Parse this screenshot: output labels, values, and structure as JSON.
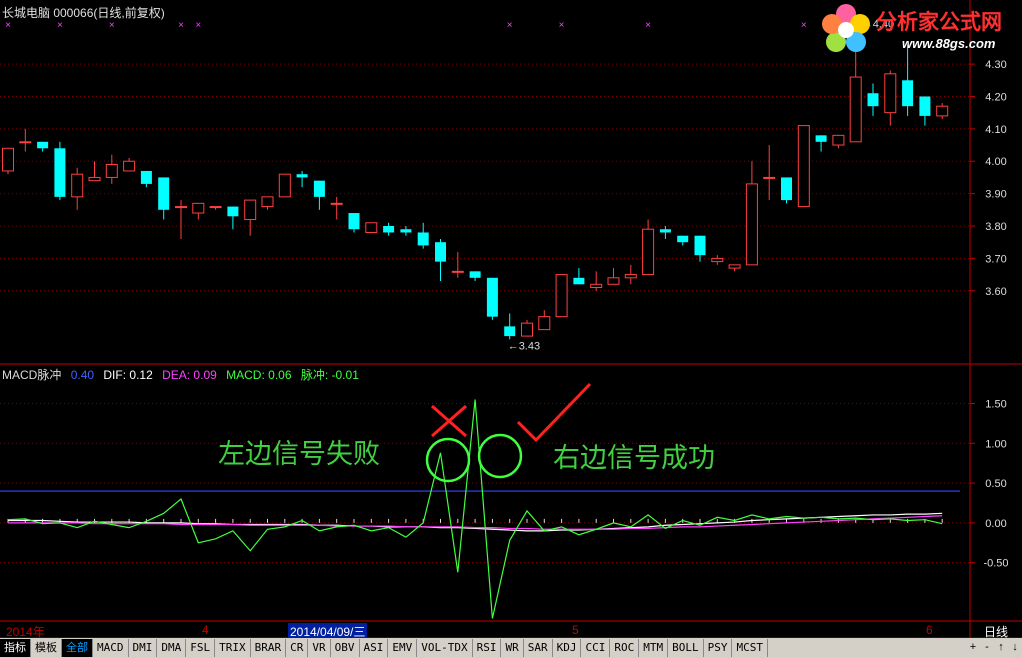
{
  "window": {
    "title": "长城电脑 000066(日线,前复权)"
  },
  "logo": {
    "brand": "分析家公式网",
    "url": "www.88gs.com"
  },
  "macd_header": {
    "name": "MACD脉冲",
    "param": "0.40",
    "dif_label": "DIF: 0.12",
    "dea_label": "DEA: 0.09",
    "macd_label": "MACD: 0.06",
    "pulse_label": "脉冲: -0.01"
  },
  "annotations": {
    "left": "左边信号失败",
    "right": "右边信号成功"
  },
  "date_axis": {
    "year": "2014年",
    "m4": "4",
    "selected_date": "2014/04/09/三",
    "m5": "5",
    "m6": "6",
    "period": "日线"
  },
  "bottom_tabs": [
    "指标",
    "模板",
    "全部",
    "MACD",
    "DMI",
    "DMA",
    "FSL",
    "TRIX",
    "BRAR",
    "CR",
    "VR",
    "OBV",
    "ASI",
    "EMV",
    "VOL-TDX",
    "RSI",
    "WR",
    "SAR",
    "KDJ",
    "CCI",
    "ROC",
    "MTM",
    "BOLL",
    "PSY",
    "MCST"
  ],
  "bottom_ctrl": [
    "+",
    "-",
    "↑",
    "↓"
  ],
  "colors": {
    "up": "#ff4040",
    "down": "#00ffff",
    "dif": "#ffffff",
    "dea": "#ff40ff",
    "pulse": "#40ff40",
    "level_line": "#4040ff",
    "grid": "#800000"
  },
  "chart_data": [
    {
      "type": "candlestick",
      "yticks": [
        3.6,
        3.7,
        3.8,
        3.9,
        4.0,
        4.1,
        4.2,
        4.3
      ],
      "ylim": [
        3.38,
        4.43
      ],
      "annotation_low": "3.43",
      "annotation_high": "4.40",
      "candles": [
        {
          "o": 3.97,
          "h": 4.04,
          "l": 3.96,
          "c": 4.04
        },
        {
          "o": 4.06,
          "h": 4.1,
          "l": 4.03,
          "c": 4.06
        },
        {
          "o": 4.06,
          "h": 4.06,
          "l": 4.03,
          "c": 4.04
        },
        {
          "o": 4.04,
          "h": 4.06,
          "l": 3.88,
          "c": 3.89
        },
        {
          "o": 3.89,
          "h": 3.98,
          "l": 3.85,
          "c": 3.96
        },
        {
          "o": 3.94,
          "h": 4.0,
          "l": 3.94,
          "c": 3.95
        },
        {
          "o": 3.95,
          "h": 4.02,
          "l": 3.93,
          "c": 3.99
        },
        {
          "o": 3.97,
          "h": 4.01,
          "l": 3.97,
          "c": 4.0
        },
        {
          "o": 3.97,
          "h": 3.97,
          "l": 3.92,
          "c": 3.93
        },
        {
          "o": 3.95,
          "h": 3.95,
          "l": 3.82,
          "c": 3.85
        },
        {
          "o": 3.86,
          "h": 3.88,
          "l": 3.76,
          "c": 3.86
        },
        {
          "o": 3.84,
          "h": 3.87,
          "l": 3.82,
          "c": 3.87
        },
        {
          "o": 3.86,
          "h": 3.86,
          "l": 3.85,
          "c": 3.86
        },
        {
          "o": 3.86,
          "h": 3.86,
          "l": 3.79,
          "c": 3.83
        },
        {
          "o": 3.82,
          "h": 3.88,
          "l": 3.77,
          "c": 3.88
        },
        {
          "o": 3.86,
          "h": 3.89,
          "l": 3.85,
          "c": 3.89
        },
        {
          "o": 3.89,
          "h": 3.96,
          "l": 3.89,
          "c": 3.96
        },
        {
          "o": 3.96,
          "h": 3.97,
          "l": 3.92,
          "c": 3.95
        },
        {
          "o": 3.94,
          "h": 3.94,
          "l": 3.85,
          "c": 3.89
        },
        {
          "o": 3.87,
          "h": 3.89,
          "l": 3.82,
          "c": 3.87
        },
        {
          "o": 3.84,
          "h": 3.84,
          "l": 3.78,
          "c": 3.79
        },
        {
          "o": 3.78,
          "h": 3.81,
          "l": 3.78,
          "c": 3.81
        },
        {
          "o": 3.8,
          "h": 3.81,
          "l": 3.77,
          "c": 3.78
        },
        {
          "o": 3.79,
          "h": 3.8,
          "l": 3.77,
          "c": 3.78
        },
        {
          "o": 3.78,
          "h": 3.81,
          "l": 3.73,
          "c": 3.74
        },
        {
          "o": 3.75,
          "h": 3.76,
          "l": 3.63,
          "c": 3.69
        },
        {
          "o": 3.66,
          "h": 3.72,
          "l": 3.64,
          "c": 3.66
        },
        {
          "o": 3.66,
          "h": 3.66,
          "l": 3.63,
          "c": 3.64
        },
        {
          "o": 3.64,
          "h": 3.64,
          "l": 3.51,
          "c": 3.52
        },
        {
          "o": 3.49,
          "h": 3.53,
          "l": 3.45,
          "c": 3.46
        },
        {
          "o": 3.46,
          "h": 3.51,
          "l": 3.46,
          "c": 3.5
        },
        {
          "o": 3.48,
          "h": 3.54,
          "l": 3.48,
          "c": 3.52
        },
        {
          "o": 3.52,
          "h": 3.65,
          "l": 3.52,
          "c": 3.65
        },
        {
          "o": 3.64,
          "h": 3.67,
          "l": 3.62,
          "c": 3.62
        },
        {
          "o": 3.61,
          "h": 3.66,
          "l": 3.6,
          "c": 3.62
        },
        {
          "o": 3.62,
          "h": 3.67,
          "l": 3.62,
          "c": 3.64
        },
        {
          "o": 3.64,
          "h": 3.68,
          "l": 3.62,
          "c": 3.65
        },
        {
          "o": 3.65,
          "h": 3.82,
          "l": 3.65,
          "c": 3.79
        },
        {
          "o": 3.79,
          "h": 3.8,
          "l": 3.76,
          "c": 3.78
        },
        {
          "o": 3.77,
          "h": 3.77,
          "l": 3.74,
          "c": 3.75
        },
        {
          "o": 3.77,
          "h": 3.77,
          "l": 3.69,
          "c": 3.71
        },
        {
          "o": 3.69,
          "h": 3.71,
          "l": 3.68,
          "c": 3.7
        },
        {
          "o": 3.67,
          "h": 3.68,
          "l": 3.66,
          "c": 3.68
        },
        {
          "o": 3.68,
          "h": 4.0,
          "l": 3.68,
          "c": 3.93
        },
        {
          "o": 3.95,
          "h": 4.05,
          "l": 3.88,
          "c": 3.95
        },
        {
          "o": 3.95,
          "h": 3.95,
          "l": 3.87,
          "c": 3.88
        },
        {
          "o": 3.86,
          "h": 4.11,
          "l": 3.86,
          "c": 4.11
        },
        {
          "o": 4.08,
          "h": 4.08,
          "l": 4.03,
          "c": 4.06
        },
        {
          "o": 4.05,
          "h": 4.08,
          "l": 4.04,
          "c": 4.08
        },
        {
          "o": 4.06,
          "h": 4.4,
          "l": 4.06,
          "c": 4.26
        },
        {
          "o": 4.21,
          "h": 4.24,
          "l": 4.14,
          "c": 4.17
        },
        {
          "o": 4.15,
          "h": 4.28,
          "l": 4.11,
          "c": 4.27
        },
        {
          "o": 4.25,
          "h": 4.36,
          "l": 4.14,
          "c": 4.17
        },
        {
          "o": 4.2,
          "h": 4.2,
          "l": 4.11,
          "c": 4.14
        },
        {
          "o": 4.14,
          "h": 4.18,
          "l": 4.13,
          "c": 4.17
        }
      ]
    },
    {
      "type": "line",
      "yticks": [
        -0.5,
        0.0,
        0.5,
        1.0,
        1.5
      ],
      "ylim": [
        -1.22,
        1.82
      ],
      "level": 0.4,
      "series": [
        {
          "name": "DIF",
          "values": [
            0.03,
            0.03,
            0.03,
            0.02,
            0.01,
            0.01,
            0.01,
            0.01,
            0.0,
            0.0,
            0.0,
            -0.01,
            -0.01,
            -0.02,
            -0.02,
            -0.02,
            -0.02,
            -0.02,
            -0.03,
            -0.03,
            -0.04,
            -0.04,
            -0.05,
            -0.05,
            -0.05,
            -0.06,
            -0.06,
            -0.07,
            -0.08,
            -0.09,
            -0.1,
            -0.1,
            -0.09,
            -0.09,
            -0.08,
            -0.07,
            -0.06,
            -0.05,
            -0.03,
            -0.02,
            -0.01,
            0.0,
            0.01,
            0.03,
            0.04,
            0.05,
            0.06,
            0.07,
            0.08,
            0.09,
            0.1,
            0.1,
            0.11,
            0.11,
            0.12
          ]
        },
        {
          "name": "DEA",
          "values": [
            0.0,
            0.0,
            0.0,
            0.0,
            0.0,
            -0.01,
            -0.01,
            -0.01,
            -0.01,
            -0.01,
            -0.02,
            -0.02,
            -0.02,
            -0.02,
            -0.03,
            -0.03,
            -0.03,
            -0.03,
            -0.03,
            -0.04,
            -0.04,
            -0.04,
            -0.04,
            -0.05,
            -0.05,
            -0.05,
            -0.05,
            -0.06,
            -0.06,
            -0.07,
            -0.07,
            -0.08,
            -0.08,
            -0.08,
            -0.08,
            -0.08,
            -0.07,
            -0.07,
            -0.06,
            -0.05,
            -0.05,
            -0.04,
            -0.03,
            -0.02,
            -0.01,
            0.0,
            0.01,
            0.02,
            0.03,
            0.04,
            0.05,
            0.06,
            0.07,
            0.08,
            0.09
          ]
        },
        {
          "name": "脉冲",
          "values": [
            0.04,
            0.05,
            -0.01,
            0.0,
            -0.06,
            0.02,
            -0.02,
            -0.06,
            0.02,
            0.12,
            0.3,
            -0.25,
            -0.2,
            -0.1,
            -0.35,
            -0.08,
            -0.05,
            0.03,
            -0.1,
            -0.05,
            -0.03,
            -0.1,
            -0.06,
            -0.18,
            0.0,
            0.88,
            -0.62,
            1.55,
            -1.2,
            -0.22,
            0.15,
            -0.1,
            -0.05,
            -0.15,
            -0.08,
            0.0,
            -0.05,
            0.1,
            -0.07,
            0.03,
            -0.03,
            0.07,
            0.03,
            0.1,
            0.05,
            0.08,
            0.06,
            0.07,
            0.05,
            0.06,
            0.04,
            0.05,
            0.03,
            0.04,
            -0.01
          ]
        }
      ]
    }
  ]
}
